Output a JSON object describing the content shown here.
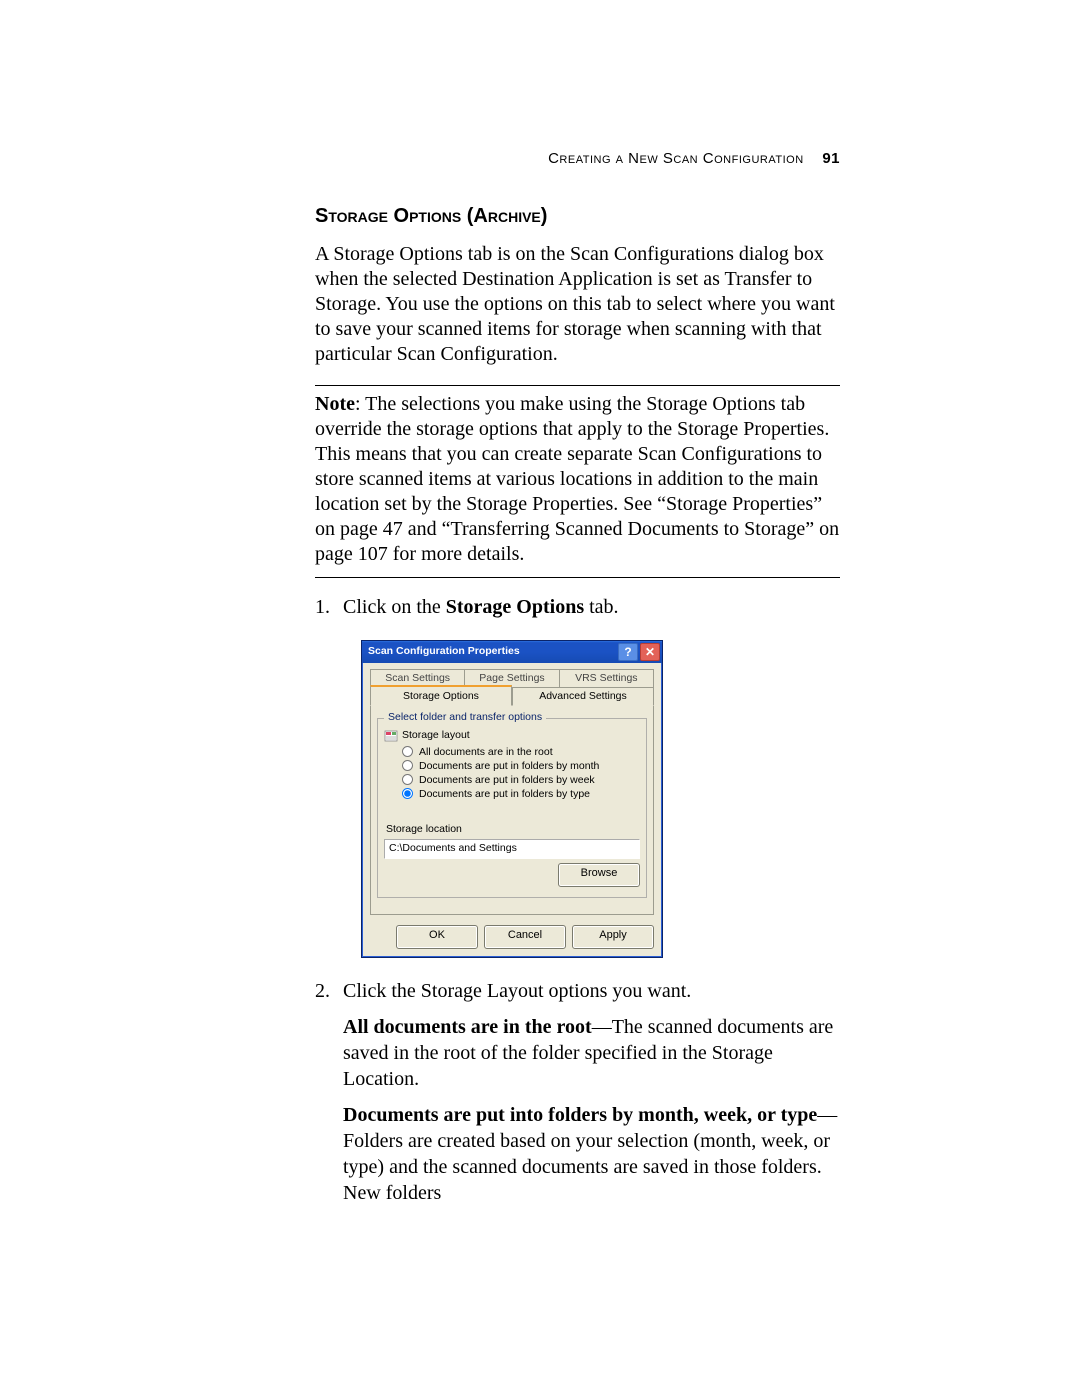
{
  "header": {
    "running_title": "Creating a New Scan Configuration",
    "page_number": "91"
  },
  "section": {
    "title": "Storage Options (Archive)",
    "intro": "A Storage Options tab is on the Scan Configurations dialog box when the selected Destination Application is set as Transfer to Storage. You use the options on this tab to select where you want to save your scanned items for storage when scanning with that particular Scan Configuration.",
    "note_label": "Note",
    "note_body": ":  The selections you make using the Storage Options tab override the storage options that apply to the Storage Properties. This means that you can create separate Scan Configurations to store scanned items at various locations in addition to the main location set by the Storage Properties. See “Storage Properties” on page 47 and “Transferring Scanned Documents to Storage” on page 107 for more details."
  },
  "steps": {
    "s1_num": "1.",
    "s1_a": "Click on the ",
    "s1_b": "Storage Options",
    "s1_c": " tab.",
    "s2_num": "2.",
    "s2_a": "Click the Storage Layout options you want.",
    "s2_p2_a": "All documents are in the root",
    "s2_p2_b": "—The scanned documents are saved in the root of the folder specified in the Storage Location.",
    "s2_p3_a": "Documents are put into folders by month, week, or type",
    "s2_p3_b": "—Folders are created based on your selection (month, week, or type) and the scanned documents are saved in those folders. New folders"
  },
  "dialog": {
    "title": "Scan Configuration Properties",
    "help_label": "?",
    "close_label": "✕",
    "tabs_back": [
      "Scan Settings",
      "Page Settings",
      "VRS Settings"
    ],
    "tabs_front": [
      "Storage Options",
      "Advanced Settings"
    ],
    "group_title": "Select folder and transfer options",
    "layout_label": "Storage layout",
    "radio_options": [
      "All documents are in the root",
      "Documents are put in folders by month",
      "Documents are put in folders by week",
      "Documents are put in folders by type"
    ],
    "selected_radio": 3,
    "location_label": "Storage location",
    "location_value": "C:\\Documents and Settings",
    "browse_button": "Browse",
    "ok_button": "OK",
    "cancel_button": "Cancel",
    "apply_button": "Apply"
  }
}
